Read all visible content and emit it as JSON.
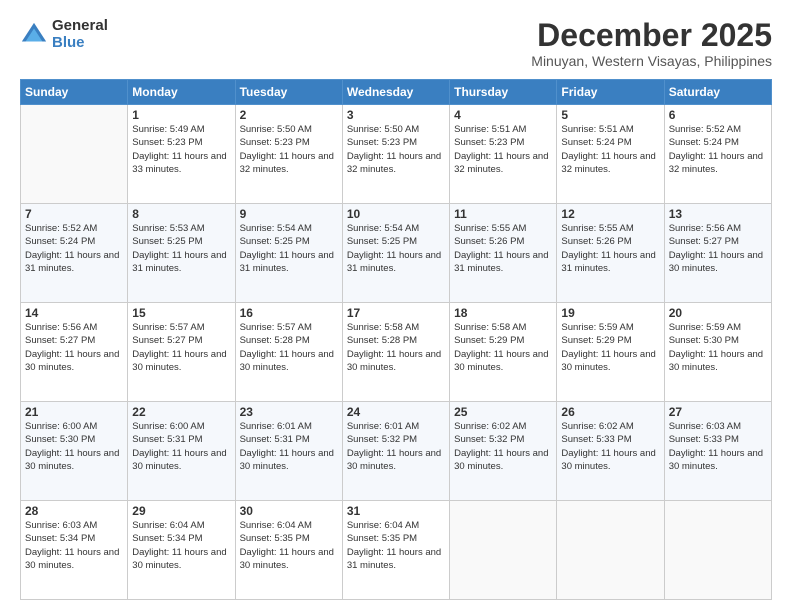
{
  "header": {
    "logo_general": "General",
    "logo_blue": "Blue",
    "month_title": "December 2025",
    "location": "Minuyan, Western Visayas, Philippines"
  },
  "days_of_week": [
    "Sunday",
    "Monday",
    "Tuesday",
    "Wednesday",
    "Thursday",
    "Friday",
    "Saturday"
  ],
  "weeks": [
    [
      {
        "day": "",
        "sunrise": "",
        "sunset": "",
        "daylight": ""
      },
      {
        "day": "1",
        "sunrise": "Sunrise: 5:49 AM",
        "sunset": "Sunset: 5:23 PM",
        "daylight": "Daylight: 11 hours and 33 minutes."
      },
      {
        "day": "2",
        "sunrise": "Sunrise: 5:50 AM",
        "sunset": "Sunset: 5:23 PM",
        "daylight": "Daylight: 11 hours and 32 minutes."
      },
      {
        "day": "3",
        "sunrise": "Sunrise: 5:50 AM",
        "sunset": "Sunset: 5:23 PM",
        "daylight": "Daylight: 11 hours and 32 minutes."
      },
      {
        "day": "4",
        "sunrise": "Sunrise: 5:51 AM",
        "sunset": "Sunset: 5:23 PM",
        "daylight": "Daylight: 11 hours and 32 minutes."
      },
      {
        "day": "5",
        "sunrise": "Sunrise: 5:51 AM",
        "sunset": "Sunset: 5:24 PM",
        "daylight": "Daylight: 11 hours and 32 minutes."
      },
      {
        "day": "6",
        "sunrise": "Sunrise: 5:52 AM",
        "sunset": "Sunset: 5:24 PM",
        "daylight": "Daylight: 11 hours and 32 minutes."
      }
    ],
    [
      {
        "day": "7",
        "sunrise": "Sunrise: 5:52 AM",
        "sunset": "Sunset: 5:24 PM",
        "daylight": "Daylight: 11 hours and 31 minutes."
      },
      {
        "day": "8",
        "sunrise": "Sunrise: 5:53 AM",
        "sunset": "Sunset: 5:25 PM",
        "daylight": "Daylight: 11 hours and 31 minutes."
      },
      {
        "day": "9",
        "sunrise": "Sunrise: 5:54 AM",
        "sunset": "Sunset: 5:25 PM",
        "daylight": "Daylight: 11 hours and 31 minutes."
      },
      {
        "day": "10",
        "sunrise": "Sunrise: 5:54 AM",
        "sunset": "Sunset: 5:25 PM",
        "daylight": "Daylight: 11 hours and 31 minutes."
      },
      {
        "day": "11",
        "sunrise": "Sunrise: 5:55 AM",
        "sunset": "Sunset: 5:26 PM",
        "daylight": "Daylight: 11 hours and 31 minutes."
      },
      {
        "day": "12",
        "sunrise": "Sunrise: 5:55 AM",
        "sunset": "Sunset: 5:26 PM",
        "daylight": "Daylight: 11 hours and 31 minutes."
      },
      {
        "day": "13",
        "sunrise": "Sunrise: 5:56 AM",
        "sunset": "Sunset: 5:27 PM",
        "daylight": "Daylight: 11 hours and 30 minutes."
      }
    ],
    [
      {
        "day": "14",
        "sunrise": "Sunrise: 5:56 AM",
        "sunset": "Sunset: 5:27 PM",
        "daylight": "Daylight: 11 hours and 30 minutes."
      },
      {
        "day": "15",
        "sunrise": "Sunrise: 5:57 AM",
        "sunset": "Sunset: 5:27 PM",
        "daylight": "Daylight: 11 hours and 30 minutes."
      },
      {
        "day": "16",
        "sunrise": "Sunrise: 5:57 AM",
        "sunset": "Sunset: 5:28 PM",
        "daylight": "Daylight: 11 hours and 30 minutes."
      },
      {
        "day": "17",
        "sunrise": "Sunrise: 5:58 AM",
        "sunset": "Sunset: 5:28 PM",
        "daylight": "Daylight: 11 hours and 30 minutes."
      },
      {
        "day": "18",
        "sunrise": "Sunrise: 5:58 AM",
        "sunset": "Sunset: 5:29 PM",
        "daylight": "Daylight: 11 hours and 30 minutes."
      },
      {
        "day": "19",
        "sunrise": "Sunrise: 5:59 AM",
        "sunset": "Sunset: 5:29 PM",
        "daylight": "Daylight: 11 hours and 30 minutes."
      },
      {
        "day": "20",
        "sunrise": "Sunrise: 5:59 AM",
        "sunset": "Sunset: 5:30 PM",
        "daylight": "Daylight: 11 hours and 30 minutes."
      }
    ],
    [
      {
        "day": "21",
        "sunrise": "Sunrise: 6:00 AM",
        "sunset": "Sunset: 5:30 PM",
        "daylight": "Daylight: 11 hours and 30 minutes."
      },
      {
        "day": "22",
        "sunrise": "Sunrise: 6:00 AM",
        "sunset": "Sunset: 5:31 PM",
        "daylight": "Daylight: 11 hours and 30 minutes."
      },
      {
        "day": "23",
        "sunrise": "Sunrise: 6:01 AM",
        "sunset": "Sunset: 5:31 PM",
        "daylight": "Daylight: 11 hours and 30 minutes."
      },
      {
        "day": "24",
        "sunrise": "Sunrise: 6:01 AM",
        "sunset": "Sunset: 5:32 PM",
        "daylight": "Daylight: 11 hours and 30 minutes."
      },
      {
        "day": "25",
        "sunrise": "Sunrise: 6:02 AM",
        "sunset": "Sunset: 5:32 PM",
        "daylight": "Daylight: 11 hours and 30 minutes."
      },
      {
        "day": "26",
        "sunrise": "Sunrise: 6:02 AM",
        "sunset": "Sunset: 5:33 PM",
        "daylight": "Daylight: 11 hours and 30 minutes."
      },
      {
        "day": "27",
        "sunrise": "Sunrise: 6:03 AM",
        "sunset": "Sunset: 5:33 PM",
        "daylight": "Daylight: 11 hours and 30 minutes."
      }
    ],
    [
      {
        "day": "28",
        "sunrise": "Sunrise: 6:03 AM",
        "sunset": "Sunset: 5:34 PM",
        "daylight": "Daylight: 11 hours and 30 minutes."
      },
      {
        "day": "29",
        "sunrise": "Sunrise: 6:04 AM",
        "sunset": "Sunset: 5:34 PM",
        "daylight": "Daylight: 11 hours and 30 minutes."
      },
      {
        "day": "30",
        "sunrise": "Sunrise: 6:04 AM",
        "sunset": "Sunset: 5:35 PM",
        "daylight": "Daylight: 11 hours and 30 minutes."
      },
      {
        "day": "31",
        "sunrise": "Sunrise: 6:04 AM",
        "sunset": "Sunset: 5:35 PM",
        "daylight": "Daylight: 11 hours and 31 minutes."
      },
      {
        "day": "",
        "sunrise": "",
        "sunset": "",
        "daylight": ""
      },
      {
        "day": "",
        "sunrise": "",
        "sunset": "",
        "daylight": ""
      },
      {
        "day": "",
        "sunrise": "",
        "sunset": "",
        "daylight": ""
      }
    ]
  ]
}
